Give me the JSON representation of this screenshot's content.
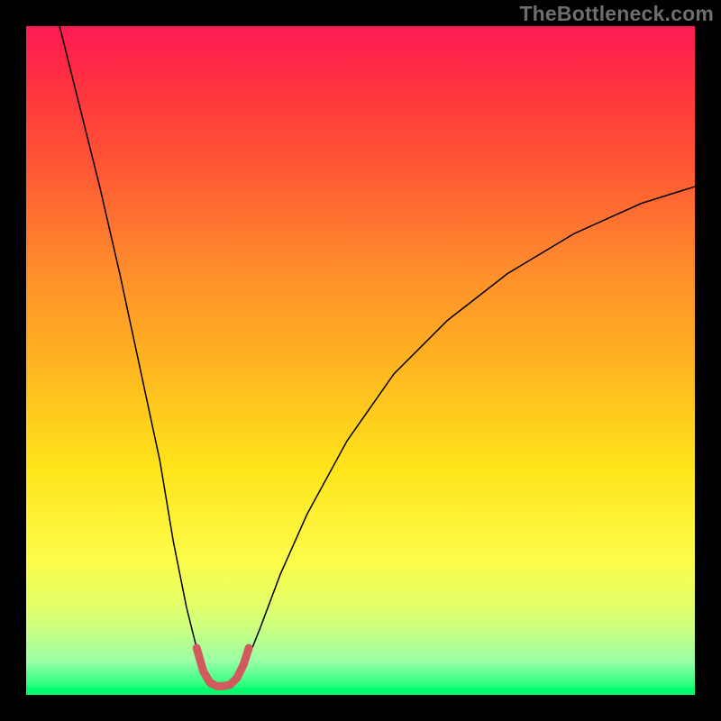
{
  "watermark": "TheBottleneck.com",
  "chart_data": {
    "type": "line",
    "title": "",
    "xlabel": "",
    "ylabel": "",
    "xlim": [
      0,
      100
    ],
    "ylim": [
      0,
      100
    ],
    "grid": false,
    "legend": false,
    "background_gradient": {
      "top": "#ff1a53",
      "mid": "#ffe41a",
      "bottom": "#00ff6e"
    },
    "series": [
      {
        "name": "bottleneck-curve-left",
        "stroke": "#000000",
        "stroke_width": 1.5,
        "x": [
          5,
          8,
          11,
          14,
          17,
          20,
          22,
          24,
          25.5,
          26.5,
          27.2
        ],
        "y": [
          100,
          88,
          76,
          63,
          49,
          35,
          23,
          13,
          7,
          3.5,
          2.5
        ]
      },
      {
        "name": "bottleneck-curve-right",
        "stroke": "#000000",
        "stroke_width": 1.5,
        "x": [
          31.5,
          33,
          35,
          38,
          42,
          48,
          55,
          63,
          72,
          82,
          92,
          100
        ],
        "y": [
          2.5,
          5,
          10,
          18,
          27,
          38,
          48,
          56,
          63,
          69,
          73.5,
          76
        ]
      },
      {
        "name": "valley-marker",
        "stroke": "#d05a5c",
        "stroke_width": 9,
        "linecap": "round",
        "x": [
          25.5,
          26.5,
          27.5,
          28.5,
          29.5,
          30.5,
          31.5,
          32.5,
          33.3
        ],
        "y": [
          7,
          3.5,
          1.8,
          1.3,
          1.3,
          1.5,
          2.5,
          4.5,
          7
        ]
      }
    ]
  }
}
